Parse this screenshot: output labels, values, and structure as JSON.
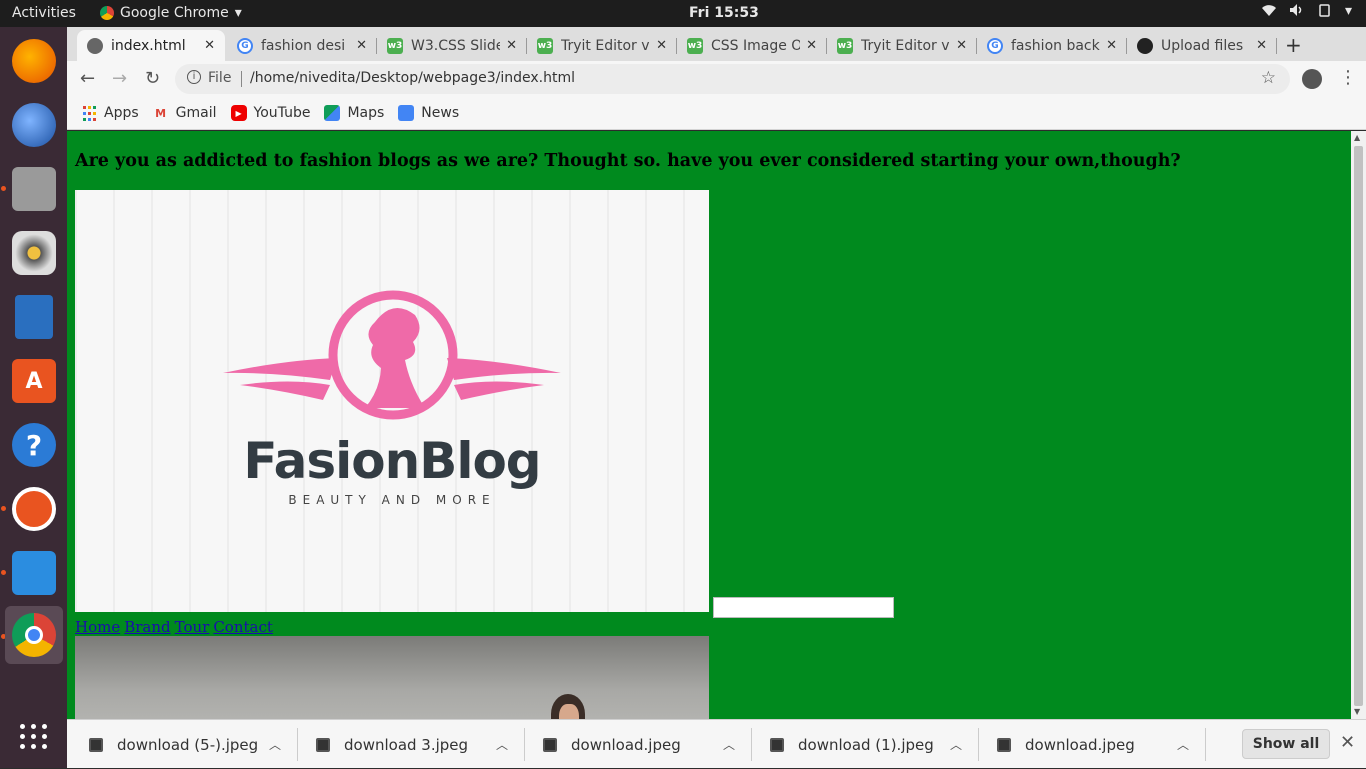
{
  "topbar": {
    "activities": "Activities",
    "app_name": "Google Chrome",
    "clock": "Fri 15:53"
  },
  "tabs": [
    {
      "title": "index.html",
      "favicon": "globe-icon",
      "active": true
    },
    {
      "title": "fashion desi",
      "favicon": "google-icon",
      "active": false
    },
    {
      "title": "W3.CSS Slide",
      "favicon": "w3schools-icon",
      "active": false
    },
    {
      "title": "Tryit Editor v",
      "favicon": "w3schools-icon",
      "active": false
    },
    {
      "title": "CSS Image O",
      "favicon": "w3schools-icon",
      "active": false
    },
    {
      "title": "Tryit Editor v",
      "favicon": "w3schools-icon",
      "active": false
    },
    {
      "title": "fashion back",
      "favicon": "google-icon",
      "active": false
    },
    {
      "title": "Upload files",
      "favicon": "github-icon",
      "active": false
    }
  ],
  "omnibox": {
    "scheme_label": "File",
    "url": "/home/nivedita/Desktop/webpage3/index.html"
  },
  "bookmarks": [
    {
      "label": "Apps",
      "icon": "apps-grid-icon"
    },
    {
      "label": "Gmail",
      "icon": "gmail-icon"
    },
    {
      "label": "YouTube",
      "icon": "youtube-icon"
    },
    {
      "label": "Maps",
      "icon": "maps-icon"
    },
    {
      "label": "News",
      "icon": "news-icon"
    }
  ],
  "page": {
    "heading": "Are you as addicted to fashion blogs as we are? Thought so. have you ever considered starting your own,though?",
    "logo_title": "FasionBlog",
    "logo_subtitle": "BEAUTY AND MORE",
    "nav": [
      "Home",
      "Brand",
      "Tour",
      "Contact"
    ],
    "background_color": "#008a1e"
  },
  "downloads": [
    {
      "filename": "download (5-).jpeg"
    },
    {
      "filename": "download 3.jpeg"
    },
    {
      "filename": "download.jpeg"
    },
    {
      "filename": "download (1).jpeg"
    },
    {
      "filename": "download.jpeg"
    }
  ],
  "shelf": {
    "show_all": "Show all"
  }
}
